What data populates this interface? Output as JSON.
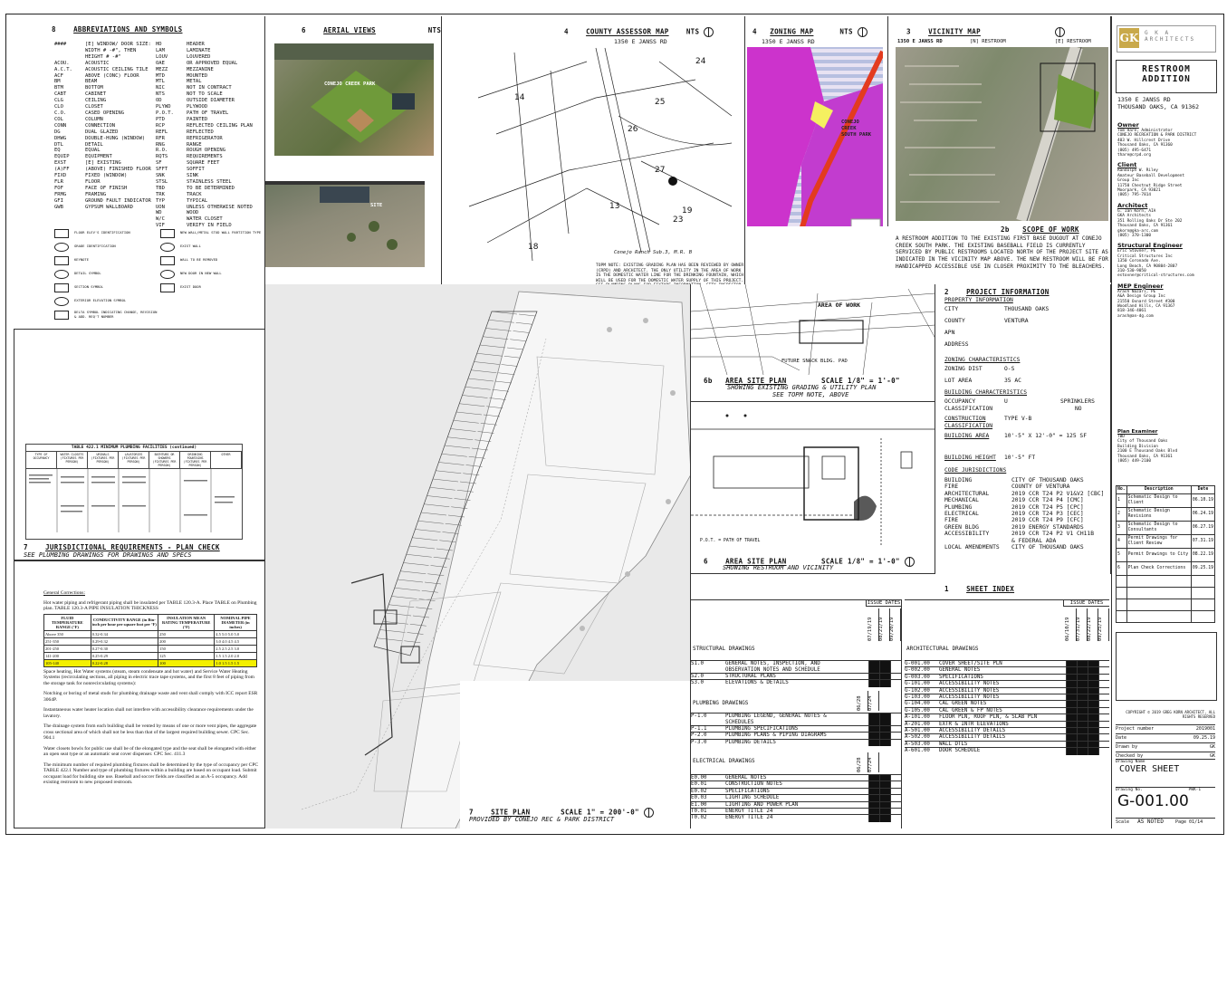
{
  "abbrev": {
    "num": "8",
    "title": "ABBREVIATIONS AND SYMBOLS",
    "left": [
      [
        "####",
        "[E] WINDOW/ DOOR SIZE:"
      ],
      [
        "",
        "WIDTH # -#\", THEN"
      ],
      [
        "",
        "HEIGHT # -#\""
      ],
      [
        "ACOU.",
        "ACOUSTIC"
      ],
      [
        "A.C.T.",
        "ACOUSTIC CEILING TILE"
      ],
      [
        "ACF",
        "ABOVE (CONC) FLOOR"
      ],
      [
        "BM",
        "BEAM"
      ],
      [
        "BTM",
        "BOTTOM"
      ],
      [
        "CABT",
        "CABINET"
      ],
      [
        "CLG",
        "CEILING"
      ],
      [
        "CLO",
        "CLOSET"
      ],
      [
        "C.O.",
        "CASED OPENING"
      ],
      [
        "COL",
        "COLUMN"
      ],
      [
        "CONN",
        "CONNECTION"
      ],
      [
        "DG",
        "DUAL GLAZED"
      ],
      [
        "DHWG",
        "DOUBLE-HUNG (WINDOW)"
      ],
      [
        "DTL",
        "DETAIL"
      ],
      [
        "EQ",
        "EQUAL"
      ],
      [
        "EQUIP",
        "EQUIPMENT"
      ],
      [
        "EXST",
        "[E] EXISTING"
      ],
      [
        "(A)FF",
        "(ABOVE) FINISHED FLOOR"
      ],
      [
        "FIXD",
        "FIXED (WINDOW)"
      ],
      [
        "FLR",
        "FLOOR"
      ],
      [
        "FOF",
        "FACE OF FINISH"
      ],
      [
        "FRMG",
        "FRAMING"
      ],
      [
        "GFI",
        "GROUND FAULT INDICATOR"
      ],
      [
        "GWB",
        "GYPSUM WALLBOARD"
      ]
    ],
    "right": [
      [
        "HD",
        "HEADER"
      ],
      [
        "LAM",
        "LAMINATE"
      ],
      [
        "LOUV",
        "LOUVERED"
      ],
      [
        "OAE",
        "OR APPROVED EQUAL"
      ],
      [
        "MEZZ",
        "MEZZANINE"
      ],
      [
        "MTD",
        "MOUNTED"
      ],
      [
        "MTL",
        "METAL"
      ],
      [
        "NIC",
        "NOT IN CONTRACT"
      ],
      [
        "NTS",
        "NOT TO SCALE"
      ],
      [
        "OD",
        "OUTSIDE DIAMETER"
      ],
      [
        "PLYWD",
        "PLYWOOD"
      ],
      [
        "P.O.T.",
        "PATH OF TRAVEL"
      ],
      [
        "PTD",
        "PAINTED"
      ],
      [
        "RCP",
        "REFLECTED CEILING PLAN"
      ],
      [
        "REFL",
        "REFLECTED"
      ],
      [
        "RFR",
        "REFRIGERATOR"
      ],
      [
        "RNG",
        "RANGE"
      ],
      [
        "R.O.",
        "ROUGH OPENING"
      ],
      [
        "RQTS",
        "REQUIREMENTS"
      ],
      [
        "SF",
        "SQUARE FEET"
      ],
      [
        "SFFT",
        "SOFFIT"
      ],
      [
        "SNK",
        "SINK"
      ],
      [
        "STSL",
        "STAINLESS STEEL"
      ],
      [
        "TBD",
        "TO BE DETERMINED"
      ],
      [
        "TRK",
        "TRACK"
      ],
      [
        "TYP",
        "TYPICAL"
      ],
      [
        "UON",
        "UNLESS OTHERWISE NOTED"
      ],
      [
        "WD",
        "WOOD"
      ],
      [
        "W/C",
        "WATER CLOSET"
      ],
      [
        "VIF",
        "VERIFY IN FIELD"
      ]
    ],
    "symbols": [
      "FLOOR ELEV'S IDENTIFICATION",
      "GRADE IDENTIFICATION",
      "KEYNOTE",
      "DETAIL SYMBOL",
      "SECTION SYMBOL",
      "EXTERIOR ELEVATION SYMBOL",
      "DELTA SYMBOL INDICATING CHANGE, REVISION & ADD. REQ'T NUMBER"
    ],
    "symbols_right": [
      "NEW WALL/METAL STUD WALL PARTITION TYPE",
      "EXIST WALL",
      "WALL TO BE REMOVED",
      "NEW DOOR IN NEW WALL",
      "EXIST DOOR"
    ]
  },
  "aerial": {
    "num": "6",
    "title": "AERIAL VIEWS",
    "scale": "NTS",
    "label1": "CONEJO CREEK PARK",
    "label2": "SITE"
  },
  "assessor": {
    "num": "4",
    "title": "COUNTY ASSESSOR MAP",
    "scale": "NTS",
    "address": "1350 E JANSS RD",
    "note": "TOPM NOTE: EXISTING GRADING PLAN HAS BEEN REVIEWED BY OWNER (CRPD) AND ARCHITECT. THE ONLY UTILITY IN THE AREA OF WORK IS THE DOMESTIC WATER LINE FOR THE DRINKING FOUNTAIN, WHICH WILL BE USED FOR THE DOMESTIC WATER SUPPLY OF THIS PROJECT. SEE PLUMBING PLANS FOR FIXTURE INFORMATION. CITY INSPECTOR TO VERIFY ALL FIELD CONDITIONS FOLLOWING EXCAVATION",
    "caption": "Conejo Ranch Sub.3, M.R. B",
    "parcels": [
      "24",
      "25",
      "26",
      "27",
      "23",
      "19",
      "18",
      "14",
      "13"
    ]
  },
  "zoning": {
    "num": "4",
    "title": "ZONING MAP",
    "scale": "NTS",
    "address": "1350 E JANSS RD",
    "park": "CONEJO CREEK SOUTH PARK"
  },
  "vicinity": {
    "num": "3",
    "title": "VICINITY MAP",
    "address": "1350 E JANSS RD",
    "n_restroom": "[N] RESTROOM",
    "e_restroom": "[E] RESTROOM"
  },
  "scope": {
    "num": "2b",
    "title": "SCOPE OF WORK",
    "text": "A RESTROOM ADDITION TO THE EXISTING FIRST BASE DUGOUT AT CONEJO CREEK SOUTH PARK. THE EXISTING BASEBALL FIELD IS CURRENTLY SERVICED BY PUBLIC RESTROOMS LOCATED NORTH OF THE PROJECT SITE AS INDICATED IN THE VICINITY MAP ABOVE. THE NEW RESTROOM WILL BE FOR HANDICAPPED ACCESSIBLE USE IN CLOSER PROXIMITY TO THE BLEACHERS."
  },
  "titleblock": {
    "firm_logo": "GK",
    "firm_name": "G K A ARCHITECTS",
    "project": "RESTROOM ADDITION",
    "address1": "1350 E JANSS RD",
    "address2": "THOUSAND OAKS, CA 91362",
    "owner_h": "Owner",
    "owner": [
      "Tom Hare, Administrator",
      "CONEJO RECREATION & PARK DISTRICT",
      "403 W. Hillcrest Drive",
      "Thousand Oaks, CA 91360",
      "(805) 495-6471",
      "thare@crpd.org"
    ],
    "client_h": "Client",
    "client": [
      "Randolph W. Riley",
      "Amateur Baseball Development",
      "Group Inc",
      "11750 Chestnut Ridge Street",
      "Moorpark, CA 93021",
      "(805) 795-7814"
    ],
    "architect_h": "Architect",
    "architect": [
      "G. Ian Korn, AIA",
      "GKA Architects",
      "351 Rolling Oaks Dr Ste 202",
      "Thousand Oaks, CA 91361",
      "gkorn@gka-arc.com",
      "(805) 370-1300"
    ],
    "struct_h": "Structural Engineer",
    "struct": [
      "Eric Stovner, PE",
      "Critical Structures Inc",
      "1350 Coronado Ave.",
      "Long Beach, CA 90804-2807",
      "310-530-9050",
      "estovner@critical-structures.com"
    ],
    "mep_h": "MEP Engineer",
    "mep": [
      "Arash Nazari, PE",
      "A&A Design Group Inc",
      "21550 Oxnard Street #300",
      "Woodland Hills, CA 91367",
      "818-346-4061",
      "arash@an-dg.com"
    ],
    "examiner_h": "Plan Examiner",
    "examiner": [
      "TBD",
      "City of Thousand Oaks",
      "Building Division",
      "2100 E Thousand Oaks Blvd",
      "Thousand Oaks, CA 91361",
      "(805) 449-2100"
    ],
    "rev_headers": [
      "No.",
      "Description",
      "Date"
    ],
    "revisions": [
      [
        "1",
        "Schematic Design to Client",
        "06.10.19"
      ],
      [
        "2",
        "Schematic Design Revisions",
        "06.24.19"
      ],
      [
        "3",
        "Schematic Design to Consultants",
        "06.27.19"
      ],
      [
        "4",
        "Permit Drawings for Client Review",
        "07.31.19"
      ],
      [
        "5",
        "Permit Drawings to City",
        "08.22.19"
      ],
      [
        "6",
        "Plan Check Corrections",
        "09.25.19"
      ]
    ],
    "copyright": "COPYRIGHT © 2019 GREG KORN ARCHITECT, ALL RIGHTS RESERVED",
    "fields": [
      [
        "Project number",
        "2019001"
      ],
      [
        "Date",
        "09.25.19"
      ],
      [
        "Drawn by",
        "GK"
      ],
      [
        "Checked by",
        "GK"
      ]
    ],
    "drawing_name_label": "Drawing Name",
    "drawing_name": "COVER SHEET",
    "drawing_no_label": "Drawing No.",
    "drawing_no_small": "PWK-1",
    "drawing_no": "G-001.00",
    "scale_label": "Scale",
    "scale": "AS NOTED",
    "page": "Page 01/14"
  },
  "project_info": {
    "num": "2",
    "title": "PROJECT INFORMATION",
    "sub": "PROPERTY INFORMATION",
    "city_l": "CITY",
    "city": "THOUSAND OAKS",
    "county_l": "COUNTY",
    "county": "VENTURA",
    "apn_l": "APN",
    "address_l": "ADDRESS",
    "zoning_h": "ZONING CHARACTERISTICS",
    "zoning_dist_l": "ZONING DIST",
    "zoning_dist": "O-S",
    "lot_area_l": "LOT AREA",
    "lot_area": "35 AC",
    "bldg_h": "BUILDING CHARACTERISTICS",
    "occ_l": "OCCUPANCY CLASSIFICATION",
    "occ": "U",
    "spr_l": "SPRINKLERS",
    "spr": "NO",
    "const_l": "CONSTRUCTION CLASSIFICATION",
    "const": "TYPE V-B",
    "area_l": "BUILDING AREA",
    "area": "10'-5\" X 12'-0\" = 125 SF",
    "height_l": "BUILDING HEIGHT",
    "height": "10'-5\" FT",
    "code_h": "CODE JURISDICTIONS",
    "codes": [
      [
        "BUILDING",
        "CITY OF THOUSAND OAKS"
      ],
      [
        "FIRE",
        "COUNTY OF VENTURA"
      ],
      [
        "ARCHITECTURAL",
        "2019 CCR T24 P2 V1&V2 [CBC]"
      ],
      [
        "MECHANICAL",
        "2019 CCR T24 P4 [CMC]"
      ],
      [
        "PLUMBING",
        "2019 CCR T24 P5 [CPC]"
      ],
      [
        "ELECTRICAL",
        "2019 CCR T24 P3 [CEC]"
      ],
      [
        "FIRE",
        "2019 CCR T24 P9 [CFC]"
      ],
      [
        "GREEN BLDG",
        "2019 ENERGY STANDARDS"
      ],
      [
        "ACCESSIBILITY",
        "2019 CCR T24 P2 V1 CH11B"
      ],
      [
        "",
        "& FEDERAL ADA"
      ],
      [
        "LOCAL AMENDMENTS",
        "CITY OF THOUSAND OAKS"
      ]
    ]
  },
  "area_plan_b": {
    "num": "6b",
    "title": "AREA SITE PLAN",
    "scale": "SCALE 1/8\" = 1'-0\"",
    "sub1": "SHOWING EXISTING GRADING & UTILITY PLAN",
    "sub2": "SEE TOPM NOTE, ABOVE",
    "area_label": "AREA OF WORK",
    "pad": "FUTURE SNACK BLDG. PAD"
  },
  "area_plan": {
    "num": "6",
    "title": "AREA SITE PLAN",
    "scale": "SCALE 1/8\" = 1'-0\"",
    "sub": "SHOWING RESTROOM AND VICINITY",
    "pot": "P.O.T. = PATH OF TRAVEL"
  },
  "juris": {
    "num": "7",
    "title": "JURISDICTIONAL REQUIREMENTS - PLAN CHECK",
    "sub": "SEE PLUMBING DRAWINGS FOR DRAWINGS AND SPECS",
    "table_title": "TABLE 422.1 MINIMUM PLUMBING FACILITIES (continued)",
    "cols": [
      "TYPE OF OCCUPANCY",
      "WATER CLOSETS (FIXTURES PER PERSON)",
      "URINALS (FIXTURES PER PERSON)",
      "LAVATORIES (FIXTURES PER PERSON)",
      "BATHTUBS OR SHOWERS (FIXTURES PER PERSON)",
      "DRINKING FOUNTAINS (FIXTURES PER PERSON)",
      "OTHER"
    ]
  },
  "corrections": {
    "heading": "General Corrections:",
    "p1": "Hot water piping and refrigerant piping shall be insulated per TABLE 120.3-A. Place TABLE on Plumbing plan. TABLE 120.3-A PIPE INSULATION THICKNESS",
    "t_cols": [
      "FLUID TEMPERATURE RANGE (°F)",
      "CONDUCTIVITY RANGE (in Btu-inch per hour per square foot per °F)",
      "INSULATION MEAN RATING TEMPERATURE (°F)",
      "NOMINAL PIPE DIAMETER (in inches)"
    ],
    "t_rows": [
      [
        "Above 350",
        "0.32-0.34",
        "250",
        "4.5 5.0 5.0 5.0"
      ],
      [
        "251-350",
        "0.29-0.32",
        "200",
        "3.0 4.0 4.5 4.5"
      ],
      [
        "201-250",
        "0.27-0.30",
        "150",
        "2.5 2.5 2.5 3.0"
      ],
      [
        "141-200",
        "0.25-0.29",
        "125",
        "1.5 1.5 2.0 2.0"
      ],
      [
        "105-140",
        "0.22-0.28",
        "100",
        "1.0 1.5 1.5 1.5"
      ]
    ],
    "p2": "Space heating, Hot Water systems (steam, steam condensate and hot water) and Service Water Heating Systems (recirculating sections, all piping in electric trace tape systems, and the first 8 feet of piping from the storage tank for nonrecirculating systems):",
    "p3": "Notching or boring of metal studs for plumbing drainage waste and vent shall comply with ICC report ESR 3064P.",
    "p4": "Instantaneous water heater location shall not interfere with accessibility clearance requirements under the lavatory.",
    "p5": "The drainage system from each building shall be vented by means of one or more vent pipes, the aggregate cross sectional area of which shall not be less than that of the largest required building sewer. CPC Sec. 904.1",
    "p6": "Water closets bowls for public use shall be of the elongated type and the seat shall be elongated with either an open seat type or an automatic seat cover dispenser. CPC Sec. 411.3",
    "p7": "The minimum number of required plumbing fixtures shall be determined by the type of occupancy per CPC TABLE 422.1 Number and type of plumbing fixtures within a building are based on occupant load. Submit occupant load for building site use. Baseball and soccer fields are classified as an A-5 occupancy. Add existing restroom to new proposed restroom."
  },
  "site_plan": {
    "num": "7",
    "title": "SITE PLAN",
    "scale": "SCALE 1\" = 200'-0\"",
    "sub": "PROVIDED BY CONEJO REC & PARK DISTRICT"
  },
  "sheet_index": {
    "num": "1",
    "title": "SHEET INDEX",
    "issue_dates": "ISSUE DATES",
    "left_dates": [
      "07/19/19",
      "08/21/19",
      "09/20/19"
    ],
    "right_dates": [
      "06/10/19",
      "07/31/19",
      "08/22/19",
      "09/25/19"
    ],
    "mid_dates1": [
      "06/28",
      "07/24"
    ],
    "mid_dates2": [
      "06/28",
      "07/24"
    ],
    "structural_h": "STRUCTURAL DRAWINGS",
    "structural": [
      [
        "S1.0",
        "GENERAL NOTES, INSPECTION, AND OBSERVATION NOTES AND SCHEDULE"
      ],
      [
        "S2.0",
        "STRUCTURAL PLANS"
      ],
      [
        "S3.0",
        "ELEVATIONS & DETAILS"
      ]
    ],
    "plumbing_h": "PLUMBING DRAWINGS",
    "plumbing": [
      [
        "P-1.0",
        "PLUMBING LEGEND, GENERAL NOTES & SCHEDULES"
      ],
      [
        "P-1.1",
        "PLUMBING SPECIFICATIONS"
      ],
      [
        "P-2.0",
        "PLUMBING PLANS & PIPING DIAGRAMS"
      ],
      [
        "P-3.0",
        "PLUMBING DETAILS"
      ]
    ],
    "electrical_h": "ELECTRICAL DRAWINGS",
    "electrical": [
      [
        "E0.00",
        "GENERAL NOTES"
      ],
      [
        "E0.01",
        "CONSTRUCTION NOTES"
      ],
      [
        "E0.02",
        "SPECIFICATIONS"
      ],
      [
        "E0.03",
        "LIGHTING SCHEDULE"
      ],
      [
        "E1.00",
        "LIGHTING AND POWER PLAN"
      ],
      [
        "T0.01",
        "ENERGY TITLE 24"
      ],
      [
        "T0.02",
        "ENERGY TITLE 24"
      ]
    ],
    "arch_h": "ARCHITECTURAL DRAWINGS",
    "arch": [
      [
        "G-001.00",
        "COVER SHEET/SITE PLN"
      ],
      [
        "G-002.00",
        "GENERAL NOTES"
      ],
      [
        "G-003.00",
        "SPECIFICATIONS"
      ],
      [
        "G-101.00",
        "ACCESSIBILITY NOTES"
      ],
      [
        "G-102.00",
        "ACCESSIBILITY NOTES"
      ],
      [
        "G-103.00",
        "ACCESSIBILITY NOTES"
      ],
      [
        "G-104.00",
        "CAL GREEN NOTES"
      ],
      [
        "G-105.00",
        "CAL GREEN & FP NOTES"
      ],
      [
        "A-101.00",
        "FLOOR PLN, ROOF PLN, & SLAB PLN"
      ],
      [
        "A-201.00",
        "EXTR & INTR ELEVATIONS"
      ],
      [
        "A-501.00",
        "ACCESSIBILITY DETAILS"
      ],
      [
        "A-502.00",
        "ACCESSIBILITY DETAILS"
      ],
      [
        "A-503.00",
        "WALL DTLS"
      ],
      [
        "A-601.00",
        "DOOR SCHEDULE"
      ]
    ]
  }
}
